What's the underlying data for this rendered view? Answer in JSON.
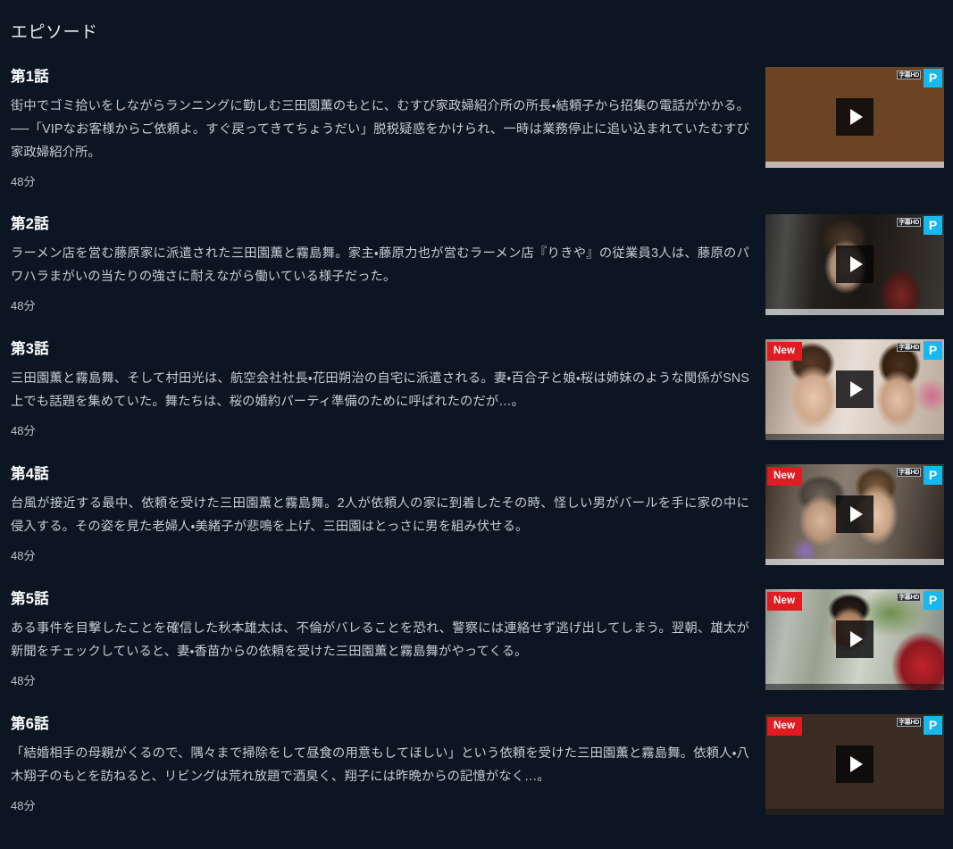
{
  "section": {
    "title": "エピソード"
  },
  "badges": {
    "new_label": "New",
    "premium_label": "P",
    "caption_label": "字幕HD",
    "new_color": "#e01b22",
    "premium_color": "#17b7f0"
  },
  "icons": {
    "play": "play-icon"
  },
  "episodes": [
    {
      "title": "第1話",
      "description": "街中でゴミ拾いをしながらランニングに勤しむ三田園薫のもとに、むすび家政婦紹介所の所長・結頼子から招集の電話がかかる。──「VIPなお客様からご依頼よ。すぐ戻ってきてちょうだい」脱税疑惑をかけられ、一時は業務停止に追い込まれていたむすび家政婦紹介所。",
      "duration": "48分",
      "is_new": false,
      "has_premium": true,
      "has_caption": true
    },
    {
      "title": "第2話",
      "description": "ラーメン店を営む藤原家に派遣された三田園薫と霧島舞。家主・藤原力也が営むラーメン店『りきや』の従業員3人は、藤原のパワハラまがいの当たりの強さに耐えながら働いている様子だった。",
      "duration": "48分",
      "is_new": false,
      "has_premium": true,
      "has_caption": true
    },
    {
      "title": "第3話",
      "description": "三田園薫と霧島舞、そして村田光は、航空会社社長・花田朔治の自宅に派遣される。妻・百合子と娘・桜は姉妹のような関係がSNS上でも話題を集めていた。舞たちは、桜の婚約パーティ準備のために呼ばれたのだが…。",
      "duration": "48分",
      "is_new": true,
      "has_premium": true,
      "has_caption": true
    },
    {
      "title": "第4話",
      "description": "台風が接近する最中、依頼を受けた三田園薫と霧島舞。2人が依頼人の家に到着したその時、怪しい男がバールを手に家の中に侵入する。その姿を見た老婦人・美緒子が悲鳴を上げ、三田園はとっさに男を組み伏せる。",
      "duration": "48分",
      "is_new": true,
      "has_premium": true,
      "has_caption": true
    },
    {
      "title": "第5話",
      "description": "ある事件を目撃したことを確信した秋本雄太は、不倫がバレることを恐れ、警察には連絡せず逃げ出してしまう。翌朝、雄太が新聞をチェックしていると、妻・香苗からの依頼を受けた三田園薫と霧島舞がやってくる。",
      "duration": "48分",
      "is_new": true,
      "has_premium": true,
      "has_caption": true
    },
    {
      "title": "第6話",
      "description": "「結婚相手の母親がくるので、隅々まで掃除をして昼食の用意もしてほしい」という依頼を受けた三田園薫と霧島舞。依頼人・八木翔子のもとを訪ねると、リビングは荒れ放題で酒臭く、翔子には昨晩からの記憶がなく…。",
      "duration": "48分",
      "is_new": true,
      "has_premium": true,
      "has_caption": true
    }
  ]
}
